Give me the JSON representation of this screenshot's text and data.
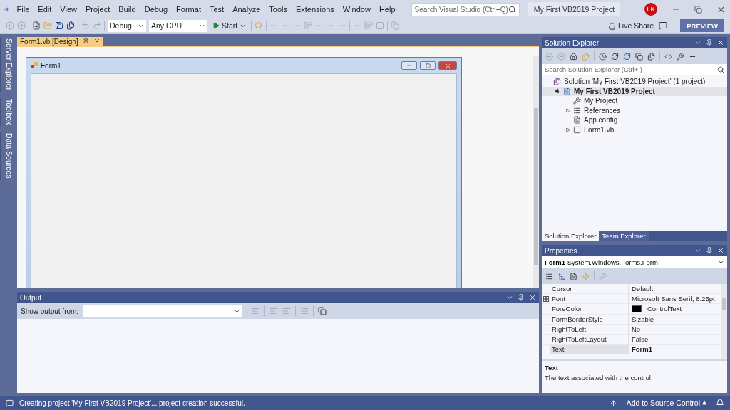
{
  "menu": [
    "File",
    "Edit",
    "View",
    "Project",
    "Build",
    "Debug",
    "Format",
    "Test",
    "Analyze",
    "Tools",
    "Extensions",
    "Window",
    "Help"
  ],
  "search": {
    "placeholder": "Search Visual Studio (Ctrl+Q)"
  },
  "solution_name": "My First VB2019 Project",
  "account": {
    "initials": "LK"
  },
  "toolbar": {
    "configuration": "Debug",
    "platform": "Any CPU",
    "start": "Start",
    "live_share": "Live Share",
    "preview": "PREVIEW"
  },
  "side_tabs": [
    "Server Explorer",
    "Toolbox",
    "Data Sources"
  ],
  "document_tabs": [
    {
      "label": "Form1.vb [Design]",
      "selected": true
    }
  ],
  "form": {
    "title": "Form1"
  },
  "output": {
    "title": "Output",
    "show_from_label": "Show output from:"
  },
  "solution_explorer": {
    "title": "Solution Explorer",
    "search_placeholder": "Search Solution Explorer (Ctrl+;)",
    "tree": [
      {
        "label": "Solution 'My First VB2019 Project' (1 project)",
        "kind": "solution",
        "selected": false,
        "children": [
          {
            "label": "My First VB2019 Project",
            "kind": "project",
            "selected": true,
            "expanded": true,
            "children": [
              {
                "label": "My Project",
                "kind": "settings",
                "selected": false
              },
              {
                "label": "References",
                "kind": "references",
                "selected": false,
                "expanded": false
              },
              {
                "label": "App.config",
                "kind": "config",
                "selected": false
              },
              {
                "label": "Form1.vb",
                "kind": "form",
                "selected": false,
                "expanded": false
              }
            ]
          }
        ]
      }
    ],
    "tabs": [
      {
        "label": "Solution Explorer",
        "selected": true
      },
      {
        "label": "Team Explorer",
        "selected": false
      }
    ]
  },
  "properties": {
    "title": "Properties",
    "object_name": "Form1",
    "object_type": "System.Windows.Forms.Form",
    "rows": [
      {
        "name": "Cursor",
        "value": "Default",
        "selected": false,
        "modified": false
      },
      {
        "name": "Font",
        "value": "Microsoft Sans Serif, 8.25pt",
        "selected": false,
        "modified": false,
        "expanded": false
      },
      {
        "name": "ForeColor",
        "value": "ControlText",
        "selected": false,
        "modified": false,
        "color": "#000000"
      },
      {
        "name": "FormBorderStyle",
        "value": "Sizable",
        "selected": false,
        "modified": false
      },
      {
        "name": "RightToLeft",
        "value": "No",
        "selected": false,
        "modified": false
      },
      {
        "name": "RightToLeftLayout",
        "value": "False",
        "selected": false,
        "modified": false
      },
      {
        "name": "Text",
        "value": "Form1",
        "selected": true,
        "modified": true
      }
    ],
    "description_title": "Text",
    "description": "The text associated with the control."
  },
  "status_bar": {
    "message": "Creating project 'My First VB2019 Project'... project creation successful.",
    "source_control": "Add to Source Control"
  }
}
